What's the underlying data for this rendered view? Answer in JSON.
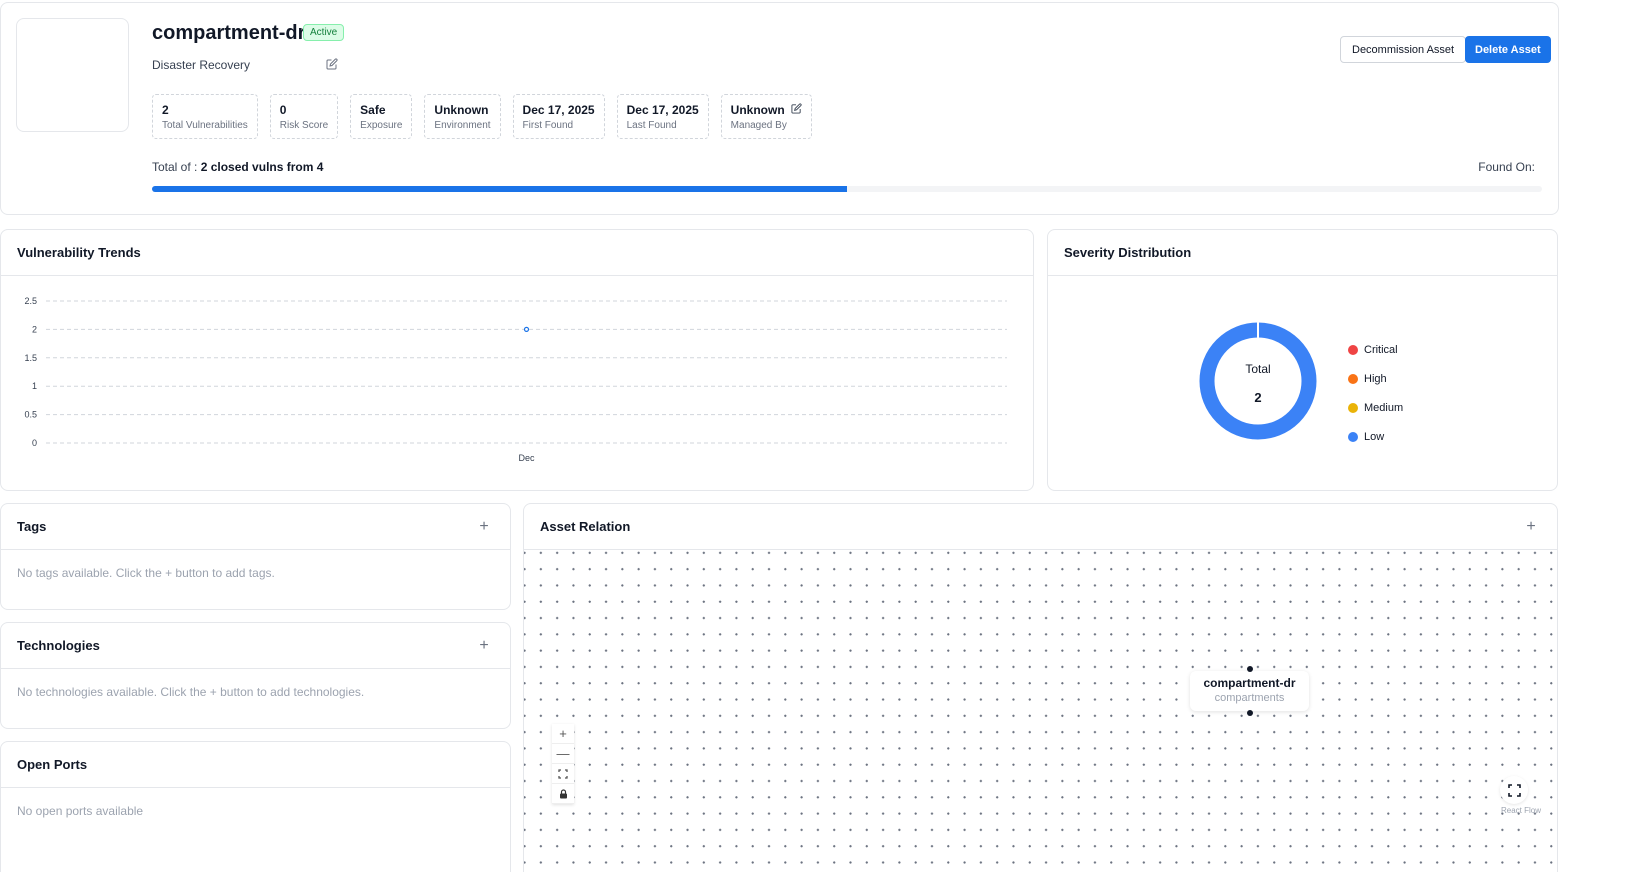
{
  "asset": {
    "name": "compartment-dr",
    "status": "Active",
    "description": "Disaster Recovery",
    "stats": [
      {
        "value": "2",
        "label": "Total Vulnerabilities"
      },
      {
        "value": "0",
        "label": "Risk Score"
      },
      {
        "value": "Safe",
        "label": "Exposure"
      },
      {
        "value": "Unknown",
        "label": "Environment"
      },
      {
        "value": "Dec 17, 2025",
        "label": "First Found"
      },
      {
        "value": "Dec 17, 2025",
        "label": "Last Found"
      },
      {
        "value": "Unknown",
        "label": "Managed By"
      }
    ],
    "total_prefix": "Total of : ",
    "total_text": "2 closed vulns from 4",
    "found_on": "Found On:",
    "closed_fraction": 0.5
  },
  "actions": {
    "decommission_label": "Decommission Asset",
    "delete_label": "Delete Asset"
  },
  "trends": {
    "title": "Vulnerability Trends"
  },
  "severity": {
    "title": "Severity Distribution",
    "total_label": "Total",
    "total_value": "2",
    "legend": [
      {
        "name": "Critical",
        "color": "#ef4444"
      },
      {
        "name": "High",
        "color": "#f97316"
      },
      {
        "name": "Medium",
        "color": "#eab308"
      },
      {
        "name": "Low",
        "color": "#3b82f6"
      }
    ]
  },
  "tags": {
    "title": "Tags",
    "empty": "No tags available. Click the + button to add tags."
  },
  "technologies": {
    "title": "Technologies",
    "empty": "No technologies available. Click the + button to add technologies."
  },
  "ports": {
    "title": "Open Ports",
    "empty": "No open ports available"
  },
  "relation": {
    "title": "Asset Relation",
    "node_title": "compartment-dr",
    "node_sub": "compartments",
    "attribution": "React Flow"
  },
  "colors": {
    "primary": "#1a73e8",
    "success_bg": "#dcfce7",
    "success_text": "#15803d"
  },
  "chart_data": [
    {
      "type": "line",
      "categories": [
        "Dec"
      ],
      "series": [
        {
          "values": [
            2
          ]
        }
      ],
      "ylim": [
        0,
        2.5
      ],
      "yticks": [
        0,
        0.5,
        1,
        1.5,
        2,
        2.5
      ],
      "grid": true,
      "xlabel": "",
      "ylabel": ""
    },
    {
      "type": "pie",
      "categories": [
        "Critical",
        "High",
        "Medium",
        "Low"
      ],
      "values": [
        0,
        0,
        0,
        2
      ],
      "donut": true
    }
  ]
}
